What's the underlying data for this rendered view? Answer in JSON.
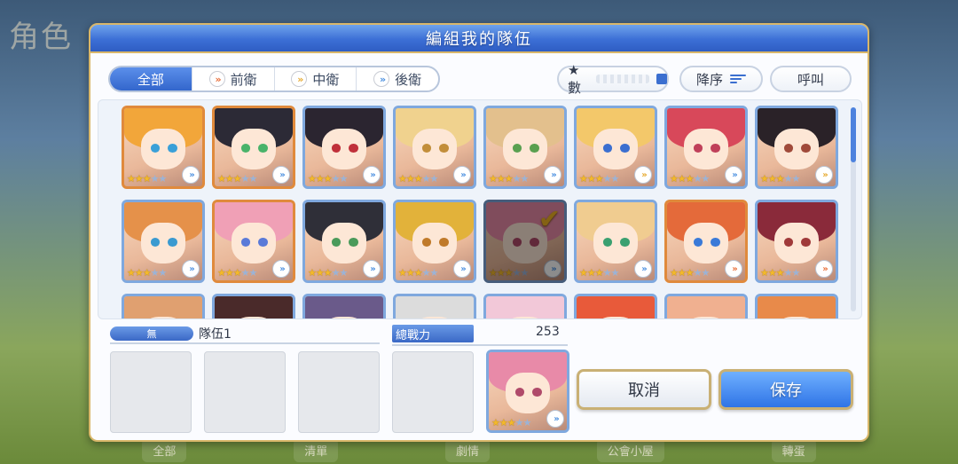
{
  "background": {
    "title": "角色",
    "bottom_nav": [
      "全部",
      "清單",
      "劇情",
      "公會小屋",
      "轉蛋"
    ]
  },
  "dialog": {
    "title": "編組我的隊伍"
  },
  "filters": {
    "tabs": [
      {
        "label": "全部",
        "active": true
      },
      {
        "label": "前衛",
        "active": false
      },
      {
        "label": "中衛",
        "active": false
      },
      {
        "label": "後衛",
        "active": false
      }
    ],
    "star_sort_label": "★數",
    "order_label": "降序",
    "call_label": "呼叫"
  },
  "roster": {
    "cards": [
      {
        "stars": 3,
        "position": "back",
        "frame": "orange",
        "hair": "#f2a63a",
        "eye": "#3aa0d8",
        "selected": false
      },
      {
        "stars": 3,
        "position": "back",
        "frame": "orange",
        "hair": "#2c2a36",
        "eye": "#49b36a",
        "selected": false
      },
      {
        "stars": 3,
        "position": "back",
        "frame": "blue",
        "hair": "#2b2530",
        "eye": "#c0303a",
        "selected": false
      },
      {
        "stars": 3,
        "position": "back",
        "frame": "blue",
        "hair": "#f0d28e",
        "eye": "#c28e3a",
        "selected": false
      },
      {
        "stars": 3,
        "position": "back",
        "frame": "blue",
        "hair": "#e3c08d",
        "eye": "#5aa050",
        "selected": false
      },
      {
        "stars": 3,
        "position": "mid",
        "frame": "blue",
        "hair": "#f3c86a",
        "eye": "#3b6fd0",
        "selected": false
      },
      {
        "stars": 3,
        "position": "back",
        "frame": "blue",
        "hair": "#d8485a",
        "eye": "#c0405a",
        "selected": false
      },
      {
        "stars": 3,
        "position": "mid",
        "frame": "blue",
        "hair": "#2a2228",
        "eye": "#a04a3a",
        "selected": false
      },
      {
        "stars": 3,
        "position": "back",
        "frame": "blue",
        "hair": "#e5914a",
        "eye": "#3a9ad0",
        "selected": false
      },
      {
        "stars": 3,
        "position": "back",
        "frame": "orange",
        "hair": "#f0a0b6",
        "eye": "#5a7ad8",
        "selected": false
      },
      {
        "stars": 3,
        "position": "back",
        "frame": "blue",
        "hair": "#2f2f38",
        "eye": "#4a9a5a",
        "selected": false
      },
      {
        "stars": 3,
        "position": "back",
        "frame": "blue",
        "hair": "#e2b23a",
        "eye": "#c07a2a",
        "selected": false
      },
      {
        "stars": 3,
        "position": "back",
        "frame": "blue",
        "hair": "#e88aa8",
        "eye": "#b04a6a",
        "selected": true
      },
      {
        "stars": 3,
        "position": "back",
        "frame": "blue",
        "hair": "#f0cc90",
        "eye": "#3aa070",
        "selected": false
      },
      {
        "stars": 3,
        "position": "front",
        "frame": "orange",
        "hair": "#e46a3a",
        "eye": "#3a7ad8",
        "selected": false
      },
      {
        "stars": 3,
        "position": "front",
        "frame": "blue",
        "hair": "#8a2a3a",
        "eye": "#a03a3a",
        "selected": false
      },
      {
        "stars": 3,
        "position": "back",
        "frame": "blue",
        "hair": "#e0a070",
        "eye": "#3a7ad8",
        "selected": false
      },
      {
        "stars": 3,
        "position": "back",
        "frame": "blue",
        "hair": "#4a2a2a",
        "eye": "#6a3a3a",
        "selected": false
      },
      {
        "stars": 3,
        "position": "back",
        "frame": "blue",
        "hair": "#6a5a8a",
        "eye": "#5a4a8a",
        "selected": false
      },
      {
        "stars": 3,
        "position": "back",
        "frame": "blue",
        "hair": "#dcdcdc",
        "eye": "#5a7ad8",
        "selected": false
      },
      {
        "stars": 3,
        "position": "back",
        "frame": "blue",
        "hair": "#f2c8d8",
        "eye": "#c06a8a",
        "selected": false
      },
      {
        "stars": 3,
        "position": "back",
        "frame": "blue",
        "hair": "#e85a3a",
        "eye": "#3a7ad8",
        "selected": false
      },
      {
        "stars": 3,
        "position": "back",
        "frame": "blue",
        "hair": "#f0b090",
        "eye": "#c05a5a",
        "selected": false
      },
      {
        "stars": 3,
        "position": "back",
        "frame": "blue",
        "hair": "#e88a4a",
        "eye": "#3a7ad8",
        "selected": false
      }
    ]
  },
  "party": {
    "team_tag": "無",
    "team_name": "隊伍1",
    "power_label": "總戰力",
    "power_value": "253",
    "member": {
      "stars": 3,
      "position": "back",
      "hair": "#e88aa8",
      "eye": "#b04a6a"
    }
  },
  "buttons": {
    "cancel": "取消",
    "save": "保存"
  },
  "colors": {
    "accent": "#3366cc",
    "gold_border": "#d9b76a",
    "star": "#f3b92a"
  }
}
